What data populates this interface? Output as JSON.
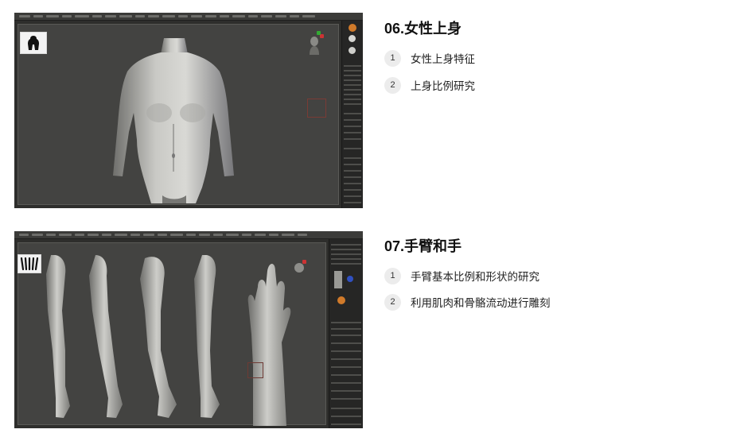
{
  "sections": [
    {
      "title": "06.女性上身",
      "items": [
        {
          "num": "1",
          "text": "女性上身特征"
        },
        {
          "num": "2",
          "text": "上身比例研究"
        }
      ]
    },
    {
      "title": "07.手臂和手",
      "items": [
        {
          "num": "1",
          "text": "手臂基本比例和形状的研究"
        },
        {
          "num": "2",
          "text": "利用肌肉和骨骼流动进行雕刻"
        }
      ]
    }
  ]
}
